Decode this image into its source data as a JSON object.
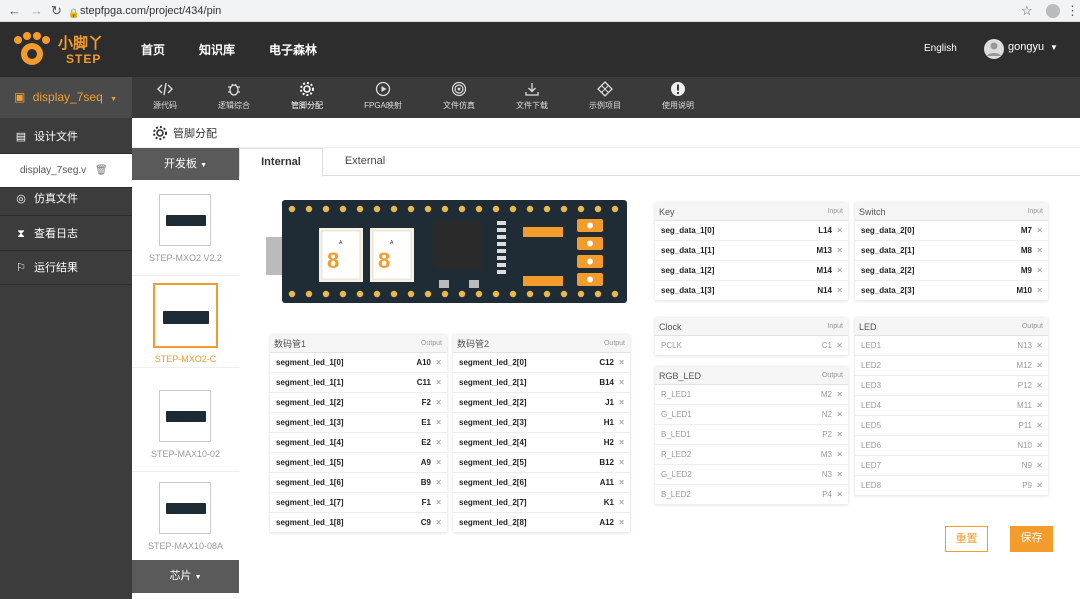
{
  "browser": {
    "url": "stepfpga.com/project/434/pin"
  },
  "header": {
    "logo_cn": "小脚丫",
    "logo_en": "STEP",
    "nav": [
      "首页",
      "知识库",
      "电子森林"
    ],
    "lang": "English",
    "user": "gongyu"
  },
  "toolbar": {
    "project": "display_7seq",
    "tools": [
      {
        "label": "源代码",
        "icon": "code-icon"
      },
      {
        "label": "逻辑综合",
        "icon": "bug-icon"
      },
      {
        "label": "管脚分配",
        "icon": "gear-icon"
      },
      {
        "label": "FPGA映射",
        "icon": "play-icon"
      },
      {
        "label": "文件仿真",
        "icon": "target-icon"
      },
      {
        "label": "文件下载",
        "icon": "download-icon"
      },
      {
        "label": "示例项目",
        "icon": "diamond-icon"
      },
      {
        "label": "使用说明",
        "icon": "info-icon"
      }
    ]
  },
  "sidebar": {
    "items": [
      "设计文件",
      "display_7seg.v",
      "仿真文件",
      "查看日志",
      "运行结果"
    ]
  },
  "page": {
    "title": "管脚分配"
  },
  "boards": {
    "header": "开发板",
    "footer": "芯片",
    "items": [
      "STEP-MXO2 V2.2",
      "STEP-MXO2-C",
      "STEP-MAX10-02",
      "STEP-MAX10-08A"
    ],
    "selected": 1
  },
  "tabs": [
    "Internal",
    "External"
  ],
  "board_diagram": {
    "digit_label": "8",
    "segments": [
      "A",
      "B",
      "C",
      "D",
      "E",
      "F",
      "G",
      "DP"
    ]
  },
  "segment1": {
    "title": "数码管1",
    "type": "Output",
    "rows": [
      [
        "segment_led_1[0]",
        "A10"
      ],
      [
        "segment_led_1[1]",
        "C11"
      ],
      [
        "segment_led_1[2]",
        "F2"
      ],
      [
        "segment_led_1[3]",
        "E1"
      ],
      [
        "segment_led_1[4]",
        "E2"
      ],
      [
        "segment_led_1[5]",
        "A9"
      ],
      [
        "segment_led_1[6]",
        "B9"
      ],
      [
        "segment_led_1[7]",
        "F1"
      ],
      [
        "segment_led_1[8]",
        "C9"
      ]
    ]
  },
  "segment2": {
    "title": "数码管2",
    "type": "Output",
    "rows": [
      [
        "segment_led_2[0]",
        "C12"
      ],
      [
        "segment_led_2[1]",
        "B14"
      ],
      [
        "segment_led_2[2]",
        "J1"
      ],
      [
        "segment_led_2[3]",
        "H1"
      ],
      [
        "segment_led_2[4]",
        "H2"
      ],
      [
        "segment_led_2[5]",
        "B12"
      ],
      [
        "segment_led_2[6]",
        "A11"
      ],
      [
        "segment_led_2[7]",
        "K1"
      ],
      [
        "segment_led_2[8]",
        "A12"
      ]
    ]
  },
  "key": {
    "title": "Key",
    "type": "Input",
    "rows": [
      [
        "seg_data_1[0]",
        "L14"
      ],
      [
        "seg_data_1[1]",
        "M13"
      ],
      [
        "seg_data_1[2]",
        "M14"
      ],
      [
        "seg_data_1[3]",
        "N14"
      ]
    ]
  },
  "switch": {
    "title": "Switch",
    "type": "Input",
    "rows": [
      [
        "seg_data_2[0]",
        "M7"
      ],
      [
        "seg_data_2[1]",
        "M8"
      ],
      [
        "seg_data_2[2]",
        "M9"
      ],
      [
        "seg_data_2[3]",
        "M10"
      ]
    ]
  },
  "clock": {
    "title": "Clock",
    "type": "Input",
    "rows": [
      [
        "PCLK",
        "C1"
      ]
    ]
  },
  "rgb": {
    "title": "RGB_LED",
    "type": "Output",
    "rows": [
      [
        "R_LED1",
        "M2"
      ],
      [
        "G_LED1",
        "N2"
      ],
      [
        "B_LED1",
        "P2"
      ],
      [
        "R_LED2",
        "M3"
      ],
      [
        "G_LED2",
        "N3"
      ],
      [
        "B_LED2",
        "P4"
      ]
    ]
  },
  "led": {
    "title": "LED",
    "type": "Output",
    "rows": [
      [
        "LED1",
        "N13"
      ],
      [
        "LED2",
        "M12"
      ],
      [
        "LED3",
        "P12"
      ],
      [
        "LED4",
        "M11"
      ],
      [
        "LED5",
        "P11"
      ],
      [
        "LED6",
        "N10"
      ],
      [
        "LED7",
        "N9"
      ],
      [
        "LED8",
        "P9"
      ]
    ]
  },
  "actions": {
    "reset": "重置",
    "save": "保存"
  },
  "colors": {
    "accent": "#f39c2c",
    "header": "#2d2d2d",
    "sidebar": "#3c3c3c"
  }
}
